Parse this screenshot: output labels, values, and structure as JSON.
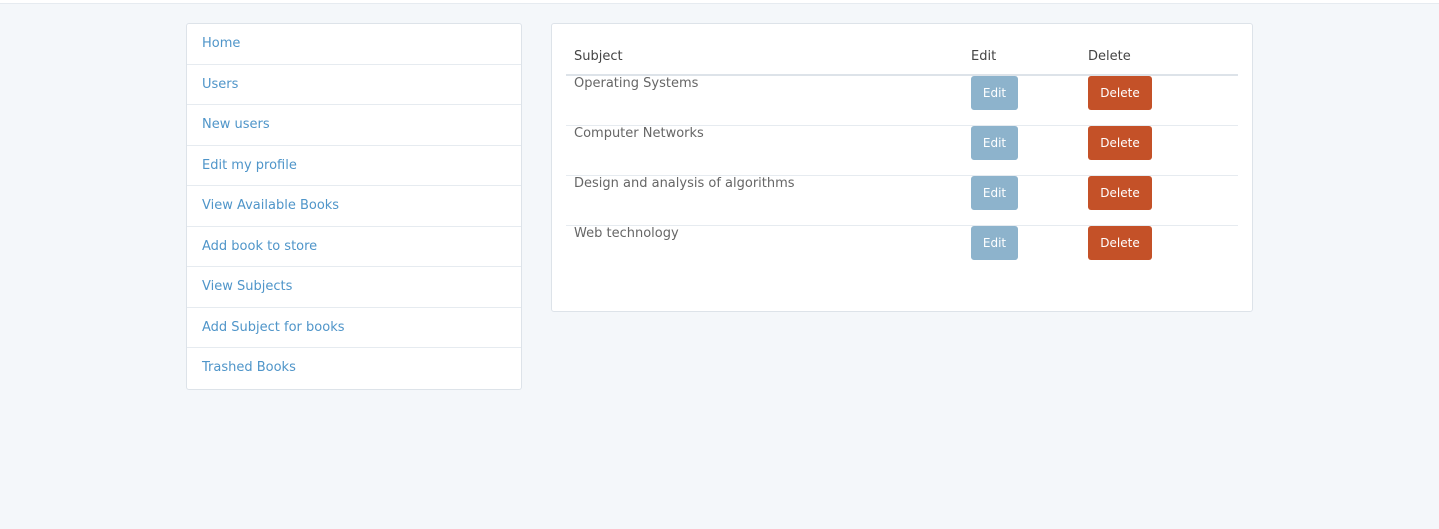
{
  "sidebar": {
    "items": [
      {
        "label": "Home"
      },
      {
        "label": "Users"
      },
      {
        "label": "New users"
      },
      {
        "label": "Edit my profile"
      },
      {
        "label": "View Available Books"
      },
      {
        "label": "Add book to store"
      },
      {
        "label": "View Subjects"
      },
      {
        "label": "Add Subject for books"
      },
      {
        "label": "Trashed Books"
      }
    ]
  },
  "table": {
    "headers": {
      "subject": "Subject",
      "edit": "Edit",
      "delete": "Delete"
    },
    "rows": [
      {
        "subject": "Operating Systems",
        "edit_label": "Edit",
        "delete_label": "Delete"
      },
      {
        "subject": "Computer Networks",
        "edit_label": "Edit",
        "delete_label": "Delete"
      },
      {
        "subject": "Design and analysis of algorithms",
        "edit_label": "Edit",
        "delete_label": "Delete"
      },
      {
        "subject": "Web technology",
        "edit_label": "Edit",
        "delete_label": "Delete"
      }
    ]
  },
  "colors": {
    "link": "#4f95c9",
    "edit_button": "#8db3cc",
    "delete_button": "#c45128",
    "background": "#f4f7fa"
  }
}
